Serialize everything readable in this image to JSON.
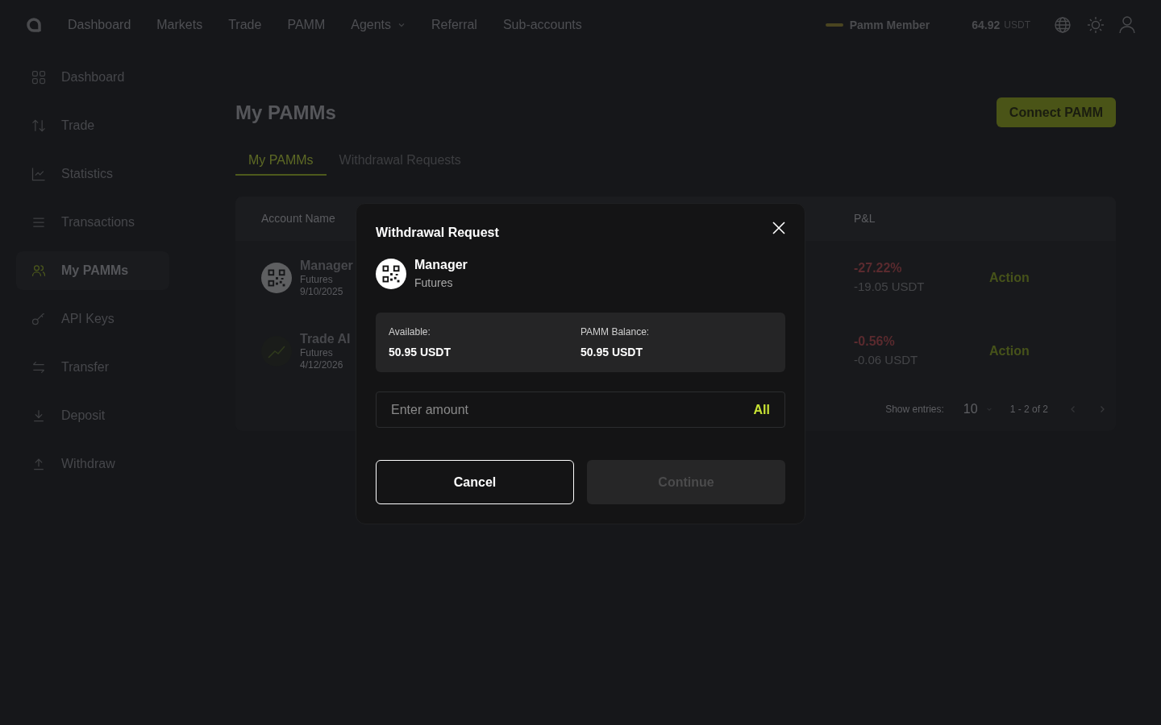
{
  "top_nav": {
    "items": [
      {
        "label": "Dashboard",
        "dropdown": false
      },
      {
        "label": "Markets",
        "dropdown": false
      },
      {
        "label": "Trade",
        "dropdown": false
      },
      {
        "label": "PAMM",
        "dropdown": false
      },
      {
        "label": "Agents",
        "dropdown": true
      },
      {
        "label": "Referral",
        "dropdown": false
      },
      {
        "label": "Sub-accounts",
        "dropdown": false
      }
    ],
    "user_level": "Pamm Member",
    "balance": "64.92",
    "balance_unit": "USDT"
  },
  "sidebar": {
    "items": [
      {
        "label": "Dashboard",
        "selected": false
      },
      {
        "label": "Trade",
        "selected": false
      },
      {
        "label": "Statistics",
        "selected": false
      },
      {
        "label": "Transactions",
        "selected": false
      },
      {
        "label": "My PAMMs",
        "selected": true
      },
      {
        "label": "API Keys",
        "selected": false
      },
      {
        "label": "Transfer",
        "selected": false
      },
      {
        "label": "Deposit",
        "selected": false
      },
      {
        "label": "Withdraw",
        "selected": false
      }
    ]
  },
  "page": {
    "title": "My PAMMs",
    "connect_button": "Connect PAMM",
    "tabs": [
      {
        "label": "My PAMMs",
        "selected": true
      },
      {
        "label": "Withdrawal Requests",
        "selected": false
      }
    ],
    "table": {
      "columns": [
        "Account Name",
        "P&L"
      ],
      "rows": [
        {
          "kind": "qr",
          "name": "Manager",
          "type": "Futures",
          "date": "9/10/2025",
          "pnl_percent": "-27.22%",
          "pnl_amount": "-19.05 USDT",
          "action": "Action"
        },
        {
          "kind": "trend",
          "name": "Trade AI",
          "type": "Futures",
          "date": "4/12/2026",
          "pnl_percent": "-0.56%",
          "pnl_amount": "-0.06 USDT",
          "action": "Action"
        }
      ]
    },
    "pagination": {
      "label": "Show entries:",
      "entries": "10",
      "range": "1 - 2 of 2"
    }
  },
  "dialog": {
    "title": "Withdrawal Request",
    "account_name": "Manager",
    "account_type": "Futures",
    "available_label": "Available:",
    "available": "50.95 USDT",
    "balance_label": "PAMM Balance:",
    "balance": "50.95 USDT",
    "amount": {
      "placeholder": "Enter amount"
    },
    "all_button": "All",
    "cancel_button": "Cancel",
    "continue_button": {
      "label": "Continue",
      "disabled": true
    }
  }
}
